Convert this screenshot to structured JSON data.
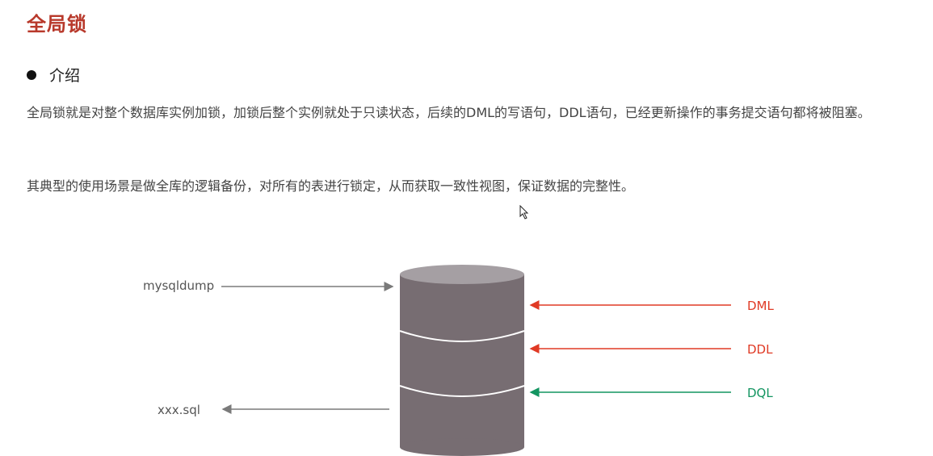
{
  "title": "全局锁",
  "section": {
    "bullet_label": "介绍"
  },
  "paragraphs": [
    "全局锁就是对整个数据库实例加锁，加锁后整个实例就处于只读状态，后续的DML的写语句，DDL语句，已经更新操作的事务提交语句都将被阻塞。",
    "其典型的使用场景是做全库的逻辑备份，对所有的表进行锁定，从而获取一致性视图，保证数据的完整性。"
  ],
  "diagram": {
    "left_labels": {
      "input": "mysqldump",
      "output": "xxx.sql"
    },
    "right_labels": {
      "dml": "DML",
      "ddl": "DDL",
      "dql": "DQL"
    },
    "colors": {
      "title": "#b8392b",
      "database_body": "#776d72",
      "database_top": "#a59fa3",
      "blocked_arrow": "#e03a25",
      "allowed_arrow": "#139561",
      "neutral_arrow": "#7a7a7a"
    }
  }
}
